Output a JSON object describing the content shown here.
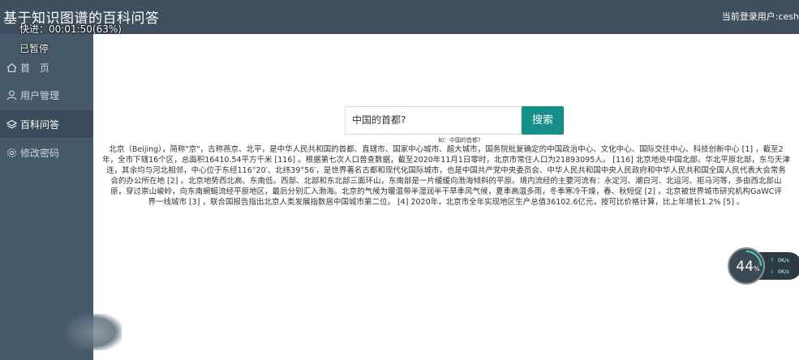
{
  "app": {
    "title": "基于知识图谱的百科问答",
    "user_label": "当前登录用户:cesh"
  },
  "overlay": {
    "progress_text": "快进：00:01:50(63%)",
    "paused_text": "已暂停"
  },
  "sidebar": {
    "items": [
      {
        "label": "首　页",
        "icon": "home-icon",
        "active": false
      },
      {
        "label": "用户管理",
        "icon": "user-icon",
        "active": false
      },
      {
        "label": "百科问答",
        "icon": "layers-icon",
        "active": true
      },
      {
        "label": "修改密码",
        "icon": "gear-icon",
        "active": false
      }
    ]
  },
  "search": {
    "value": "中国的首都?",
    "button_label": "搜索",
    "hint": "如：中国的首都?"
  },
  "answer": {
    "lines": [
      "北京（Beijing），简称\"京\"，古称燕京、北平，是中华人民共和国的首都、直辖市、国家中心城市、超大城市，国务院批复确定的中国政治中心、文化中心、国际交往中心、科技创新中心 [1] ，截至2",
      "年，全市下辖16个区，总面积16410.54平方千米 [116] 。根据第七次人口普查数据，截至2020年11月1日零时，北京市常住人口为21893095人。 [116] 北京地处中国北部、华北平原北部，东与天津",
      "连，其余均与河北相邻，中心位于东经116°20′、北纬39°56′，是世界著名古都和现代化国际城市，也是中国共产党中央委员会、中华人民共和国中央人民政府和中华人民共和国全国人民代表大会常务",
      "会的办公所在地 [2] 。北京地势西北高、东南低。西部、北部和东北部三面环山，东南部是一片缓缓向渤海倾斜的平原。境内流经的主要河流有：永定河、潮白河、北运河、拒马河等，多由西北部山",
      "原，穿过崇山峻岭，向东南蜿蜒流经平原地区，最后分别汇入渤海。北京的气候为暖温带半湿润半干旱季风气候，夏季高温多雨，冬季寒冷干燥，春、秋短促 [2] 。北京被世界城市研究机构GaWC评",
      "界一线城市 [3] ，联合国报告指出北京人类发展指数居中国城市第二位。 [4] 2020年，北京市全年实现地区生产总值36102.6亿元，按可比价格计算，比上年增长1.2% [5] 。"
    ]
  },
  "speed_widget": {
    "percent": "44",
    "percent_unit": "%",
    "upload": "0K/s",
    "download": "0K/s"
  }
}
